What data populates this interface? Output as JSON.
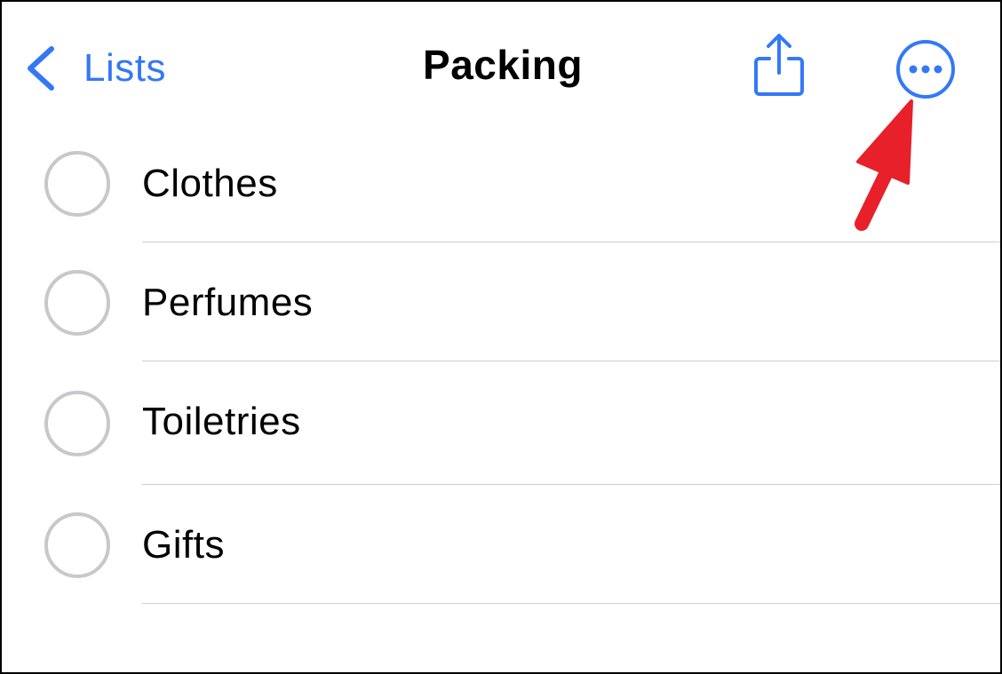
{
  "colors": {
    "accent": "#3478f6",
    "annotation_arrow": "#e8202a",
    "checkbox_border": "#c8c8cc",
    "separator": "#cfcfd2"
  },
  "navbar": {
    "back_label": "Lists",
    "back_icon": "chevron-left-icon",
    "title": "Packing",
    "share_icon": "share-icon",
    "more_icon": "ellipsis-circle-icon"
  },
  "reminders": [
    {
      "title": "Clothes",
      "completed": false
    },
    {
      "title": "Perfumes",
      "completed": false
    },
    {
      "title": "Toiletries",
      "completed": false
    },
    {
      "title": "Gifts",
      "completed": false
    }
  ]
}
